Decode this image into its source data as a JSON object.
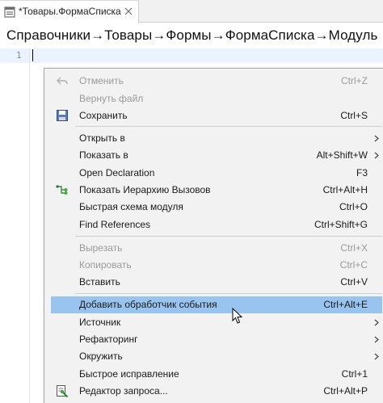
{
  "tab": {
    "title": "*Товары.ФормаСписка",
    "icon": "form-module-icon",
    "close_icon": "close-icon"
  },
  "breadcrumb": "Справочники→Товары→Формы→ФормаСписка→Модуль",
  "editor": {
    "line_number": "1"
  },
  "menu": {
    "items": [
      {
        "label": "Отменить",
        "shortcut": "Ctrl+Z",
        "icon": "undo-icon",
        "enabled": false
      },
      {
        "label": "Вернуть файл",
        "shortcut": "",
        "icon": "",
        "enabled": false
      },
      {
        "label": "Сохранить",
        "shortcut": "Ctrl+S",
        "icon": "save-icon",
        "enabled": true
      },
      {
        "label": "Открыть в",
        "shortcut": "",
        "icon": "",
        "enabled": true,
        "submenu": true
      },
      {
        "label": "Показать в",
        "shortcut": "Alt+Shift+W",
        "icon": "",
        "enabled": true,
        "submenu": true
      },
      {
        "label": "Open Declaration",
        "shortcut": "F3",
        "icon": "",
        "enabled": true
      },
      {
        "label": "Показать Иерархию Вызовов",
        "shortcut": "Ctrl+Alt+H",
        "icon": "call-hierarchy-icon",
        "enabled": true
      },
      {
        "label": "Быстрая схема модуля",
        "shortcut": "Ctrl+O",
        "icon": "",
        "enabled": true
      },
      {
        "label": "Find References",
        "shortcut": "Ctrl+Shift+G",
        "icon": "",
        "enabled": true
      },
      {
        "label": "Вырезать",
        "shortcut": "Ctrl+X",
        "icon": "",
        "enabled": false
      },
      {
        "label": "Копировать",
        "shortcut": "Ctrl+C",
        "icon": "",
        "enabled": false
      },
      {
        "label": "Вставить",
        "shortcut": "Ctrl+V",
        "icon": "",
        "enabled": true
      },
      {
        "label": "Добавить обработчик события",
        "shortcut": "Ctrl+Alt+E",
        "icon": "",
        "enabled": true,
        "highlighted": true
      },
      {
        "label": "Источник",
        "shortcut": "",
        "icon": "",
        "enabled": true,
        "submenu": true
      },
      {
        "label": "Рефакторинг",
        "shortcut": "",
        "icon": "",
        "enabled": true,
        "submenu": true
      },
      {
        "label": "Окружить",
        "shortcut": "",
        "icon": "",
        "enabled": true,
        "submenu": true
      },
      {
        "label": "Быстрое исправление",
        "shortcut": "Ctrl+1",
        "icon": "",
        "enabled": true
      },
      {
        "label": "Редактор запроса...",
        "shortcut": "Ctrl+Alt+P",
        "icon": "query-editor-icon",
        "enabled": true
      }
    ]
  },
  "colors": {
    "highlight": "#99c4ef",
    "menu_bg": "#f2f2f2",
    "disabled_text": "#9a9a9a"
  }
}
